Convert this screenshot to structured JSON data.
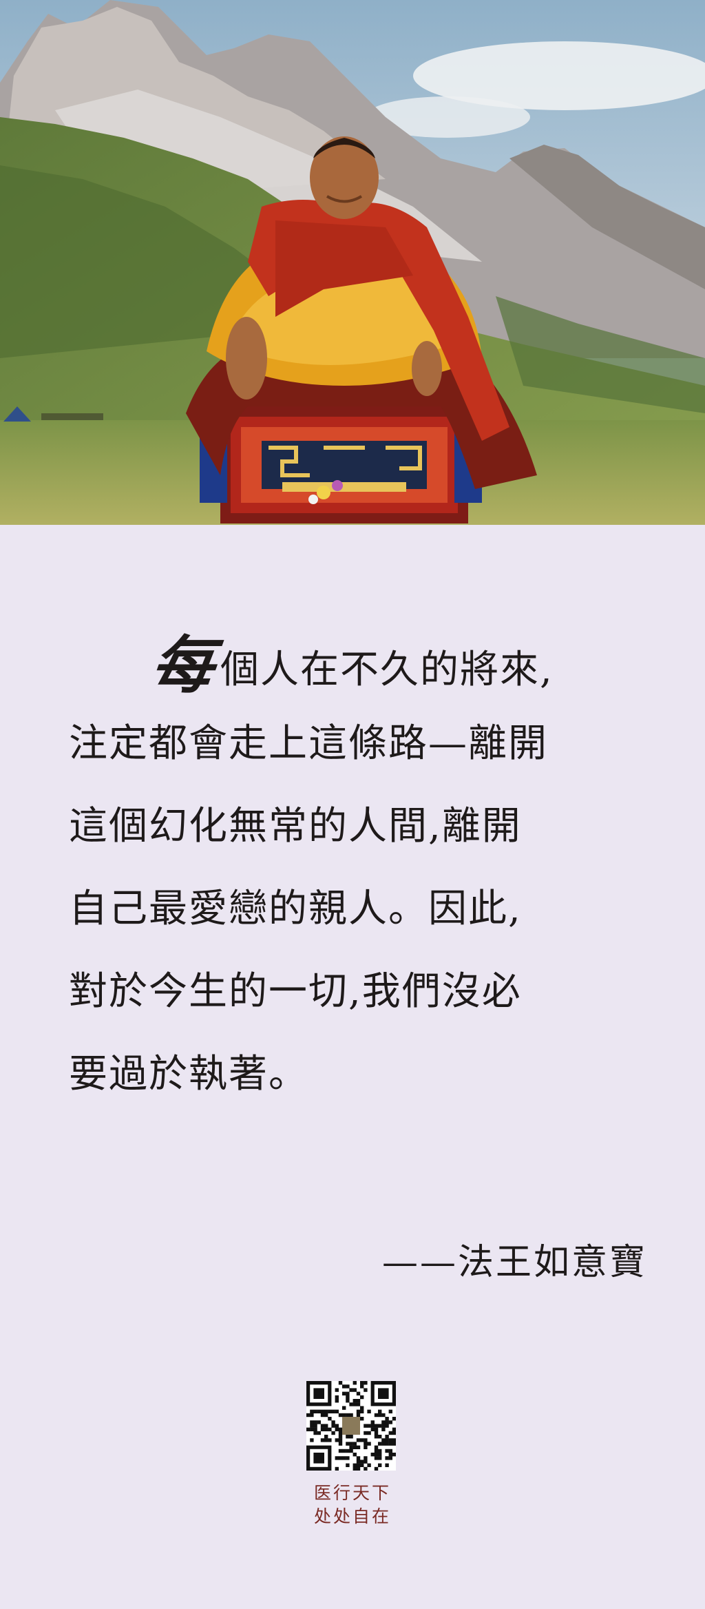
{
  "photo": {
    "subject": "monk-seated-on-throne-before-mountains",
    "colors": {
      "sky": "#a9c2d6",
      "mountain": "#b8b2ae",
      "grass": "#6f8a3c",
      "robe_red": "#b72a18",
      "robe_yellow": "#e6a21a",
      "carpet": "#8a1c18"
    }
  },
  "quote": {
    "drop_char": "每",
    "lines": [
      "個人在不久的將來,",
      "注定都會走上這條路—離開",
      "這個幻化無常的人間,離開",
      "自己最愛戀的親人。因此,",
      "對於今生的一切,我們沒必",
      "要過於執著。"
    ]
  },
  "signature": "——法王如意寶",
  "footer": {
    "qr_icon": "qr-code-icon",
    "line1": "医行天下",
    "line2": "处处自在"
  },
  "colors": {
    "background": "#ebe6f2",
    "text": "#1e1a1a",
    "footer_text": "#7a2a24"
  }
}
